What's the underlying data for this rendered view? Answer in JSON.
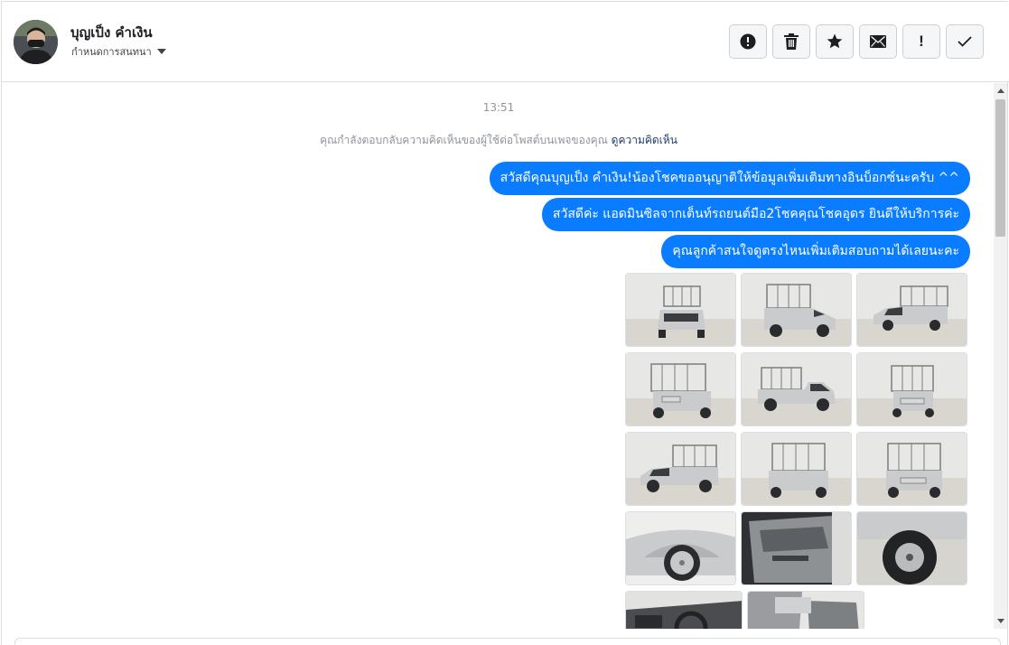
{
  "header": {
    "contact_name": "บุญเป็ง คำเงิน",
    "assign_label": "กำหนดการสนทนา",
    "actions": [
      {
        "name": "report-button",
        "icon": "alert-circle-icon"
      },
      {
        "name": "delete-button",
        "icon": "trash-icon"
      },
      {
        "name": "star-button",
        "icon": "star-icon"
      },
      {
        "name": "mark-unread-button",
        "icon": "envelope-icon"
      },
      {
        "name": "priority-button",
        "icon": "exclamation-icon",
        "glyph": "!"
      },
      {
        "name": "done-button",
        "icon": "check-icon"
      }
    ]
  },
  "thread": {
    "timestamp": "13:51",
    "notice_text": "คุณกำลังตอบกลับความคิดเห็นของผู้ใช้ต่อโพสต์บนเพจของคุณ",
    "notice_link": "ดูความคิดเห็น",
    "messages": [
      "สวัสดีคุณบุญเป็ง คำเงิน!น้องโชคขออนุญาติให้ข้อมูลเพิ่มเติมทางอินบ็อกซ์นะครับ ^^",
      "สวัสดีค่ะ แอดมินซิลจากเต็นท์รถยนต์มือ2โชคคุณโชคอุดร ยินดีให้บริการค่ะ",
      "คุณลูกค้าสนใจดูตรงไหนเพิ่มเติมสอบถามได้เลยนะคะ"
    ]
  },
  "colors": {
    "bubble": "#0a7cff",
    "car_body": "#c9cbcd",
    "rack": "#7a7d80",
    "floor": "#d9d6cf"
  }
}
